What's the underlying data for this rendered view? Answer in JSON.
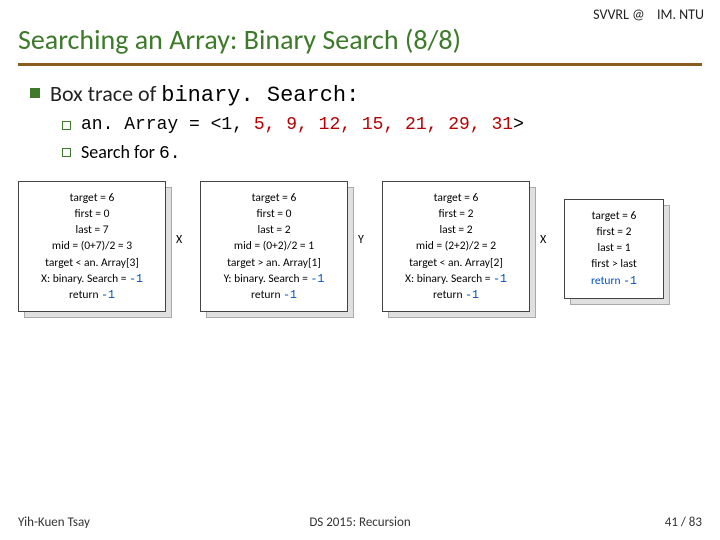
{
  "header": {
    "left": "SVVRL @",
    "right": "IM. NTU"
  },
  "title": "Searching an Array: Binary Search (8/8)",
  "bullet1": {
    "pre": "Box trace of ",
    "code": "binary. Search:"
  },
  "bullet2a": {
    "pre": "an. Array = <1, ",
    "red": "5, 9, 12, 15, 21, 29, 31",
    "post": ">"
  },
  "bullet2b": {
    "pre": "Search for ",
    "code": "6."
  },
  "boxes": [
    {
      "lines": [
        "target = 6",
        "first = 0",
        "last = 7",
        "mid = (0+7)/2 = 3",
        "target < an. Array[3]"
      ],
      "callLabel": "X: binary. Search = ",
      "callVal": "-1",
      "retLabel": "return ",
      "retVal": "-1"
    },
    {
      "lines": [
        "target = 6",
        "first = 0",
        "last = 2",
        "mid = (0+2)/2 = 1",
        "target > an. Array[1]"
      ],
      "callLabel": "Y: binary. Search = ",
      "callVal": "-1",
      "retLabel": "return ",
      "retVal": "-1"
    },
    {
      "lines": [
        "target = 6",
        "first = 2",
        "last = 2",
        "mid = (2+2)/2 = 2",
        "target < an. Array[2]"
      ],
      "callLabel": "X: binary. Search = ",
      "callVal": "-1",
      "retLabel": "return ",
      "retVal": "-1"
    }
  ],
  "smallBox": {
    "lines": [
      "target = 6",
      "first = 2",
      "last = 1",
      "first > last"
    ],
    "retLabel": "return ",
    "retVal": "-1"
  },
  "connectors": [
    "X",
    "Y",
    "X"
  ],
  "footer": {
    "left": "Yih-Kuen Tsay",
    "center": "DS 2015: Recursion",
    "right": "41 / 83"
  }
}
